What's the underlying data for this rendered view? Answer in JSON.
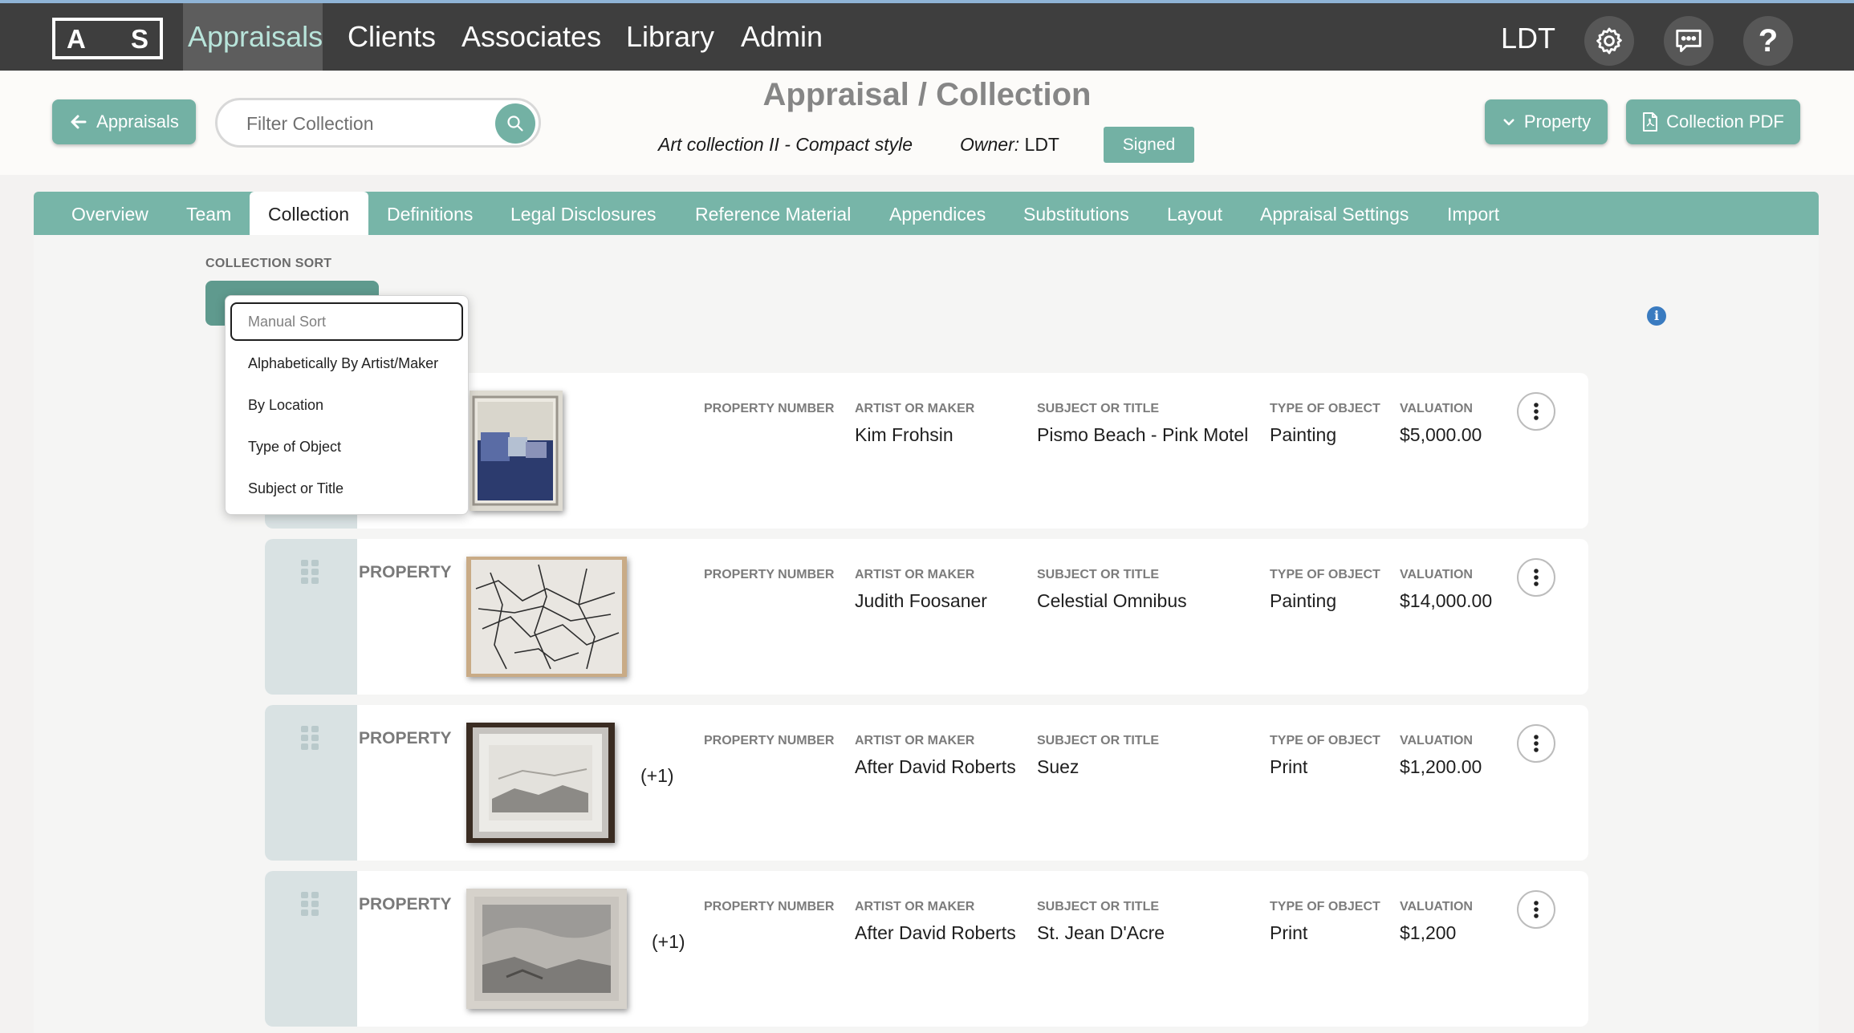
{
  "logo": {
    "left": "A",
    "right": "S"
  },
  "nav": {
    "items": [
      "Appraisals",
      "Clients",
      "Associates",
      "Library",
      "Admin"
    ],
    "user_initials": "LDT"
  },
  "header": {
    "back_label": "Appraisals",
    "filter_placeholder": "Filter Collection",
    "title": "Appraisal / Collection",
    "subtitle": "Art collection II - Compact style",
    "owner_label": "Owner:",
    "owner_value": "LDT",
    "status": "Signed",
    "property_label": "Property",
    "pdf_label": "Collection PDF"
  },
  "tabs": [
    "Overview",
    "Team",
    "Collection",
    "Definitions",
    "Legal Disclosures",
    "Reference Material",
    "Appendices",
    "Substitutions",
    "Layout",
    "Appraisal Settings",
    "Import"
  ],
  "active_tab": "Collection",
  "sort": {
    "label": "COLLECTION SORT",
    "selected": "Manual Sort",
    "options": [
      "Alphabetically By Artist/Maker",
      "By Location",
      "Type of Object",
      "Subject or Title"
    ]
  },
  "columns": {
    "property_number": "PROPERTY NUMBER",
    "artist": "ARTIST OR MAKER",
    "subject": "SUBJECT OR TITLE",
    "type": "TYPE OF OBJECT",
    "valuation": "VALUATION"
  },
  "properties": [
    {
      "label": "",
      "property_number": "",
      "artist": "Kim Frohsin",
      "subject": "Pismo Beach - Pink Motel",
      "type": "Painting",
      "valuation": "$5,000.00",
      "extra_images": ""
    },
    {
      "label": "PROPERTY",
      "property_number": "",
      "artist": "Judith Foosaner",
      "subject": "Celestial Omnibus",
      "type": "Painting",
      "valuation": "$14,000.00",
      "extra_images": ""
    },
    {
      "label": "PROPERTY",
      "property_number": "",
      "artist": "After David Roberts",
      "subject": "Suez",
      "type": "Print",
      "valuation": "$1,200.00",
      "extra_images": "(+1)"
    },
    {
      "label": "PROPERTY",
      "property_number": "",
      "artist": "After David Roberts",
      "subject": "St. Jean D'Acre",
      "type": "Print",
      "valuation": "$1,200",
      "extra_images": "(+1)"
    }
  ],
  "colors": {
    "accent": "#73b1a4",
    "topbar": "#3e3e3e",
    "info": "#3a7bc0"
  }
}
